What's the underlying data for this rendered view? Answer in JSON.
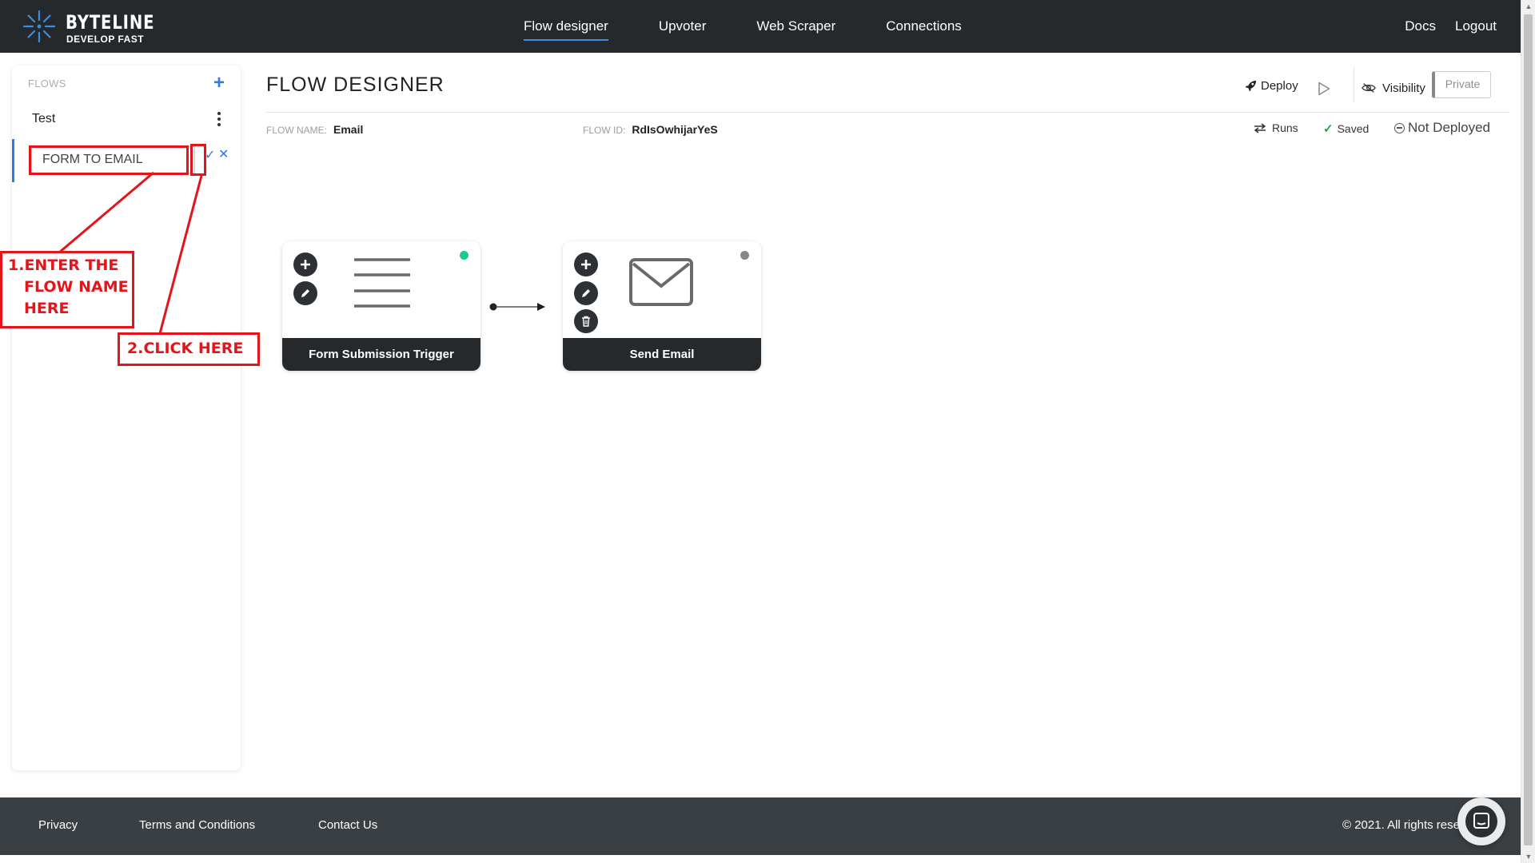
{
  "brand": {
    "name": "BYTELINE",
    "tagline": "DEVELOP FAST",
    "accent": "#3b8ddf"
  },
  "nav": {
    "items": [
      {
        "label": "Flow designer",
        "active": true
      },
      {
        "label": "Upvoter"
      },
      {
        "label": "Web Scraper"
      },
      {
        "label": "Connections"
      }
    ],
    "right": [
      {
        "label": "Docs"
      },
      {
        "label": "Logout"
      }
    ]
  },
  "sidebar": {
    "title": "FLOWS",
    "add_icon": "plus-icon",
    "items": [
      {
        "label": "Test"
      }
    ],
    "edit": {
      "value": "FORM TO EMAIL",
      "confirm_icon": "check-icon",
      "cancel_icon": "close-icon"
    }
  },
  "main": {
    "title": "FLOW DESIGNER",
    "toolbar": {
      "deploy_label": "Deploy",
      "visibility_label": "Visibility",
      "private_label": "Private"
    },
    "meta": {
      "flow_name_label": "FLOW NAME:",
      "flow_name": "Email",
      "flow_id_label": "FLOW ID:",
      "flow_id": "RdIsOwhijarYeS"
    },
    "status": {
      "runs_label": "Runs",
      "saved_label": "Saved",
      "deploy_status": "Not Deployed"
    }
  },
  "nodes": [
    {
      "label": "Form Submission Trigger",
      "icon": "form-lines-icon",
      "status_color": "#1fc98b"
    },
    {
      "label": "Send Email",
      "icon": "envelope-icon",
      "status_color": "#888888"
    }
  ],
  "annotations": {
    "step1": [
      "1.ENTER THE",
      "FLOW NAME",
      "HERE"
    ],
    "step2": "2.CLICK HERE",
    "color": "#e3141a"
  },
  "footer": {
    "links": [
      {
        "label": "Privacy"
      },
      {
        "label": "Terms and Conditions"
      },
      {
        "label": "Contact Us"
      }
    ],
    "copyright": "© 2021. All rights reser"
  }
}
